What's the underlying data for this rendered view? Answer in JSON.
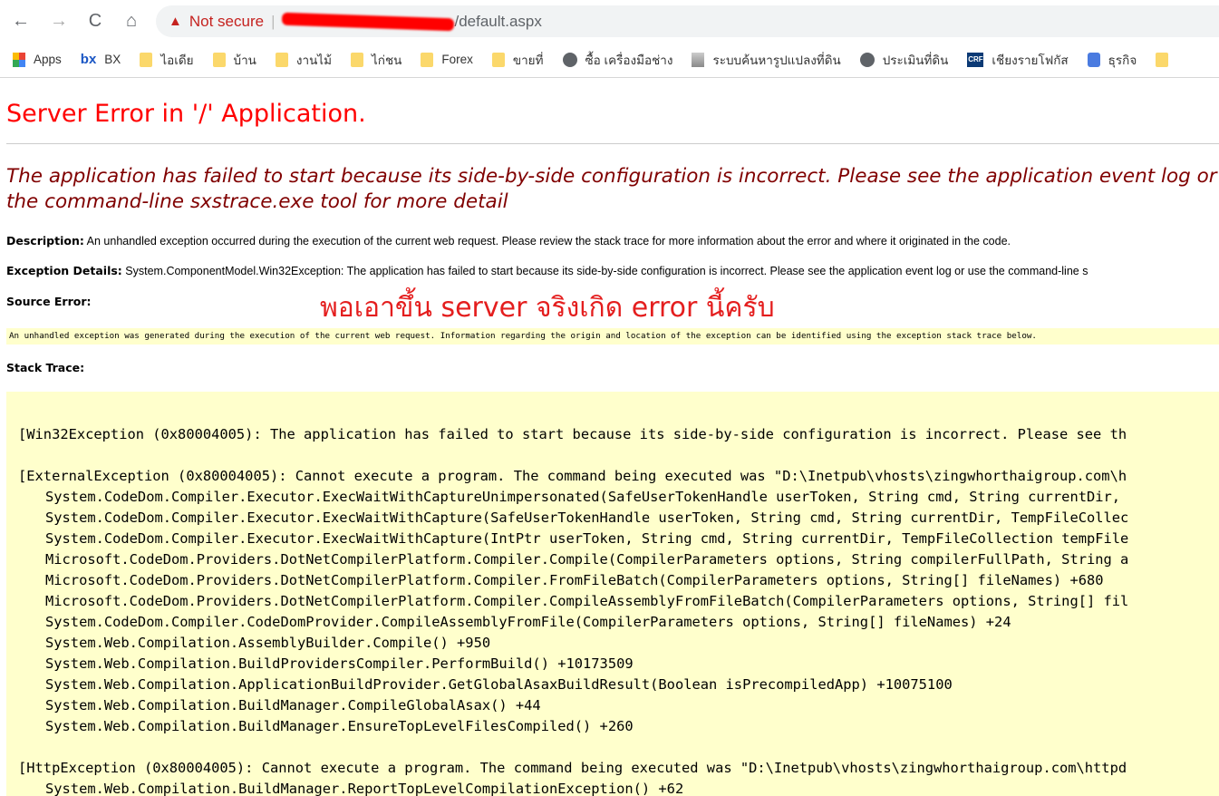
{
  "browser": {
    "nav": {
      "back": "←",
      "forward": "→",
      "reload": "C",
      "home": "⌂"
    },
    "security_label": "Not secure",
    "url_visible": "/default.aspx",
    "bookmarks": [
      {
        "icon": "apps-grid-icon",
        "label": "Apps"
      },
      {
        "icon": "bx-logo-icon",
        "label": "BX"
      },
      {
        "icon": "folder-icon",
        "label": "ไอเดีย"
      },
      {
        "icon": "folder-icon",
        "label": "บ้าน"
      },
      {
        "icon": "folder-icon",
        "label": "งานไม้"
      },
      {
        "icon": "folder-icon",
        "label": "ไก่ชน"
      },
      {
        "icon": "folder-icon",
        "label": "Forex"
      },
      {
        "icon": "folder-icon",
        "label": "ขายที่"
      },
      {
        "icon": "globe-icon",
        "label": "ซื้อ เครื่องมือช่าง"
      },
      {
        "icon": "box-icon",
        "label": "ระบบค้นหารูปแปลงที่ดิน"
      },
      {
        "icon": "globe-icon",
        "label": "ประเมินที่ดิน"
      },
      {
        "icon": "crf-logo-icon",
        "label": "เชียงรายโฟกัส"
      },
      {
        "icon": "business-icon",
        "label": "ธุรกิจ"
      },
      {
        "icon": "folder-icon",
        "label": ""
      }
    ]
  },
  "error": {
    "title": "Server Error in '/' Application.",
    "message": "The application has failed to start because its side-by-side configuration is incorrect. Please see the application event log or use the command-line sxstrace.exe tool for more detail",
    "description_label": "Description:",
    "description": "An unhandled exception occurred during the execution of the current web request. Please review the stack trace for more information about the error and where it originated in the code.",
    "exception_label": "Exception Details:",
    "exception": "System.ComponentModel.Win32Exception: The application has failed to start because its side-by-side configuration is incorrect. Please see the application event log or use the command-line s",
    "source_label": "Source Error:",
    "source_text": "An unhandled exception was generated during the execution of the current web request. Information regarding the origin and location of the exception can be identified using the exception stack trace below.",
    "stack_label": "Stack Trace:",
    "annotation": "พอเอาขึ้น server จริงเกิด error นี้ครับ",
    "stack": [
      {
        "text": "[Win32Exception (0x80004005): The application has failed to start because its side-by-side configuration is incorrect. Please see th",
        "indent": false
      },
      {
        "text": "",
        "indent": false
      },
      {
        "text": "[ExternalException (0x80004005): Cannot execute a program. The command being executed was \"D:\\Inetpub\\vhosts\\zingwhorthaigroup.com\\h",
        "indent": false
      },
      {
        "text": "System.CodeDom.Compiler.Executor.ExecWaitWithCaptureUnimpersonated(SafeUserTokenHandle userToken, String cmd, String currentDir,",
        "indent": true
      },
      {
        "text": "System.CodeDom.Compiler.Executor.ExecWaitWithCapture(SafeUserTokenHandle userToken, String cmd, String currentDir, TempFileCollec",
        "indent": true
      },
      {
        "text": "System.CodeDom.Compiler.Executor.ExecWaitWithCapture(IntPtr userToken, String cmd, String currentDir, TempFileCollection tempFile",
        "indent": true
      },
      {
        "text": "Microsoft.CodeDom.Providers.DotNetCompilerPlatform.Compiler.Compile(CompilerParameters options, String compilerFullPath, String a",
        "indent": true
      },
      {
        "text": "Microsoft.CodeDom.Providers.DotNetCompilerPlatform.Compiler.FromFileBatch(CompilerParameters options, String[] fileNames) +680",
        "indent": true
      },
      {
        "text": "Microsoft.CodeDom.Providers.DotNetCompilerPlatform.Compiler.CompileAssemblyFromFileBatch(CompilerParameters options, String[] fil",
        "indent": true
      },
      {
        "text": "System.CodeDom.Compiler.CodeDomProvider.CompileAssemblyFromFile(CompilerParameters options, String[] fileNames) +24",
        "indent": true
      },
      {
        "text": "System.Web.Compilation.AssemblyBuilder.Compile() +950",
        "indent": true
      },
      {
        "text": "System.Web.Compilation.BuildProvidersCompiler.PerformBuild() +10173509",
        "indent": true
      },
      {
        "text": "System.Web.Compilation.ApplicationBuildProvider.GetGlobalAsaxBuildResult(Boolean isPrecompiledApp) +10075100",
        "indent": true
      },
      {
        "text": "System.Web.Compilation.BuildManager.CompileGlobalAsax() +44",
        "indent": true
      },
      {
        "text": "System.Web.Compilation.BuildManager.EnsureTopLevelFilesCompiled() +260",
        "indent": true
      },
      {
        "text": "",
        "indent": false
      },
      {
        "text": "[HttpException (0x80004005): Cannot execute a program. The command being executed was \"D:\\Inetpub\\vhosts\\zingwhorthaigroup.com\\httpd",
        "indent": false
      },
      {
        "text": "System.Web.Compilation.BuildManager.ReportTopLevelCompilationException() +62",
        "indent": true
      }
    ],
    "colors": {
      "title": "#ff0000",
      "message": "#800000",
      "code_bg": "#ffffcc",
      "annotation": "#e41e1e"
    }
  }
}
